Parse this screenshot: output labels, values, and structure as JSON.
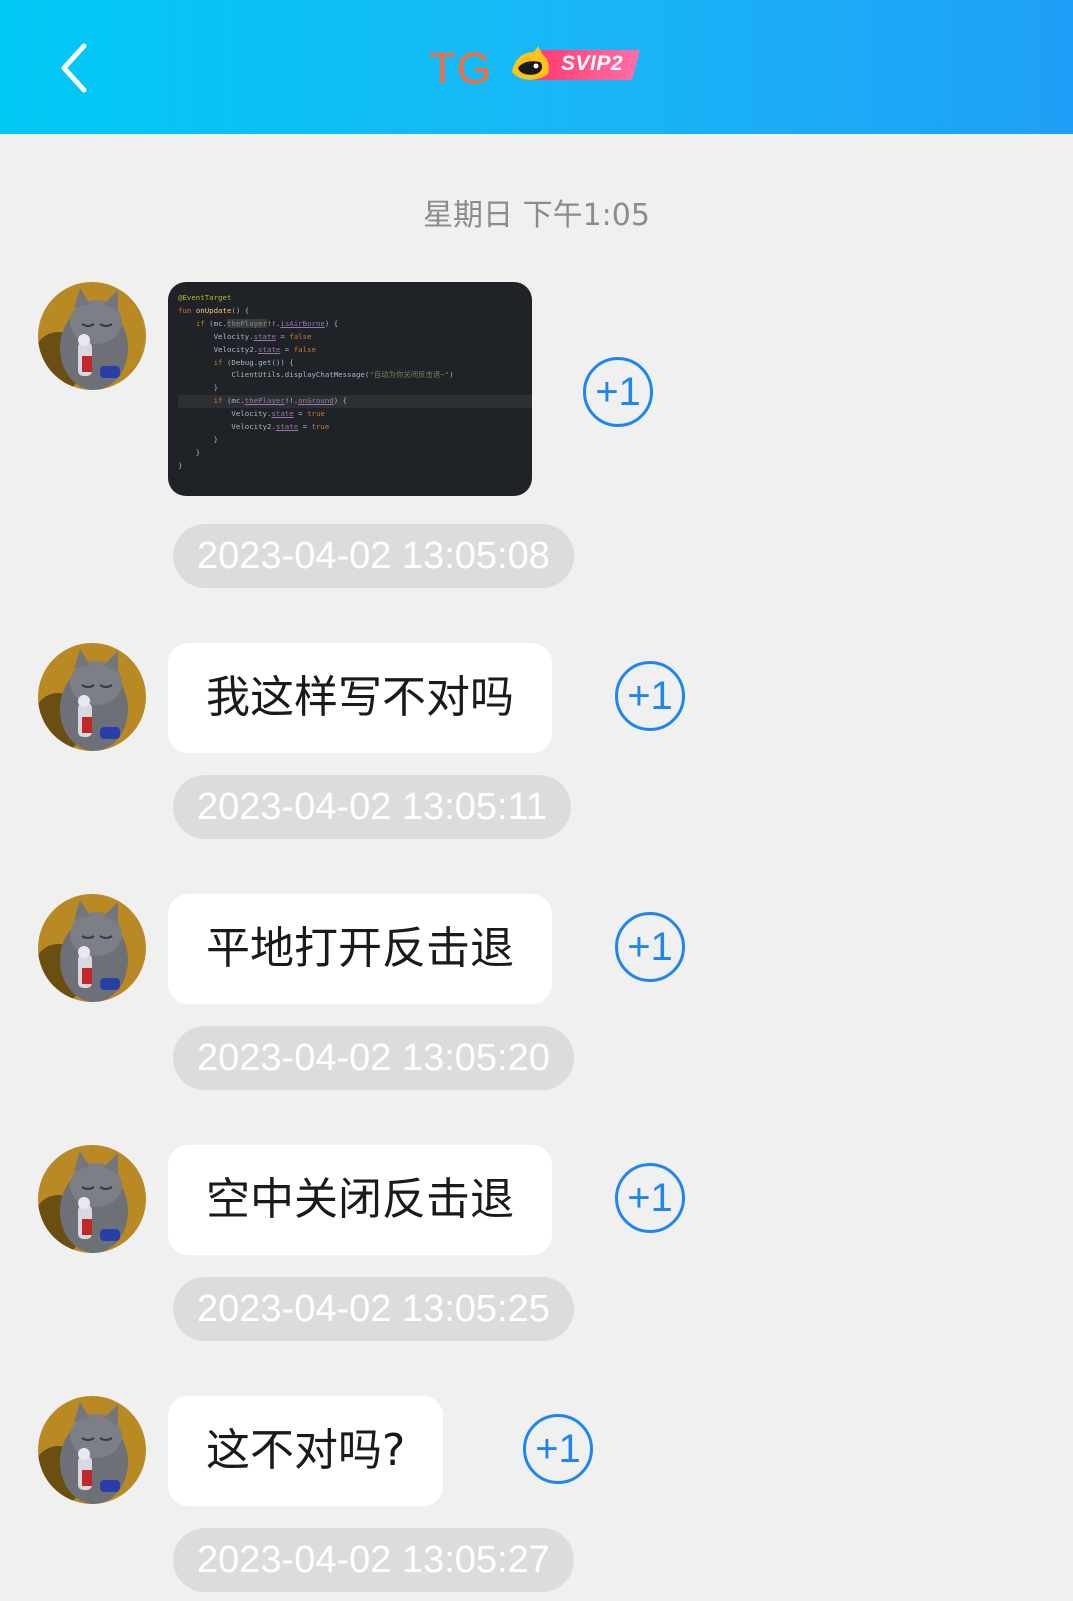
{
  "header": {
    "title": "TG",
    "badge_text": "SVIP2",
    "back_icon": "chevron-left-icon",
    "colors": {
      "bar_start": "#00c9f4",
      "bar_end": "#1e9ff7",
      "title": "#ff6a3a"
    }
  },
  "date_separator": "星期日 下午1:05",
  "plus_one_label": "+1",
  "code_image": {
    "lines": [
      "@EventTarget",
      "fun onUpdate() {",
      "    if (mc.thePlayer!!.isAirBorne) {",
      "        Velocity.state = false",
      "        Velocity2.state = false",
      "        if (Debug.get()) {",
      "            ClientUtils.displayChatMessage(\"自动为你关闭反击退~\")",
      "        }",
      "        if (mc.thePlayer!!.onGround) {",
      "            Velocity.state = true",
      "            Velocity2.state = true",
      "        }",
      "    }",
      "}"
    ]
  },
  "messages": [
    {
      "type": "image",
      "timestamp": "2023-04-02 13:05:08"
    },
    {
      "type": "text",
      "text": "我这样写不对吗",
      "timestamp": "2023-04-02 13:05:11"
    },
    {
      "type": "text",
      "text": "平地打开反击退",
      "timestamp": "2023-04-02 13:05:20"
    },
    {
      "type": "text",
      "text": "空中关闭反击退",
      "timestamp": "2023-04-02 13:05:25"
    },
    {
      "type": "text",
      "text": "这不对吗?",
      "timestamp": "2023-04-02 13:05:27"
    }
  ]
}
